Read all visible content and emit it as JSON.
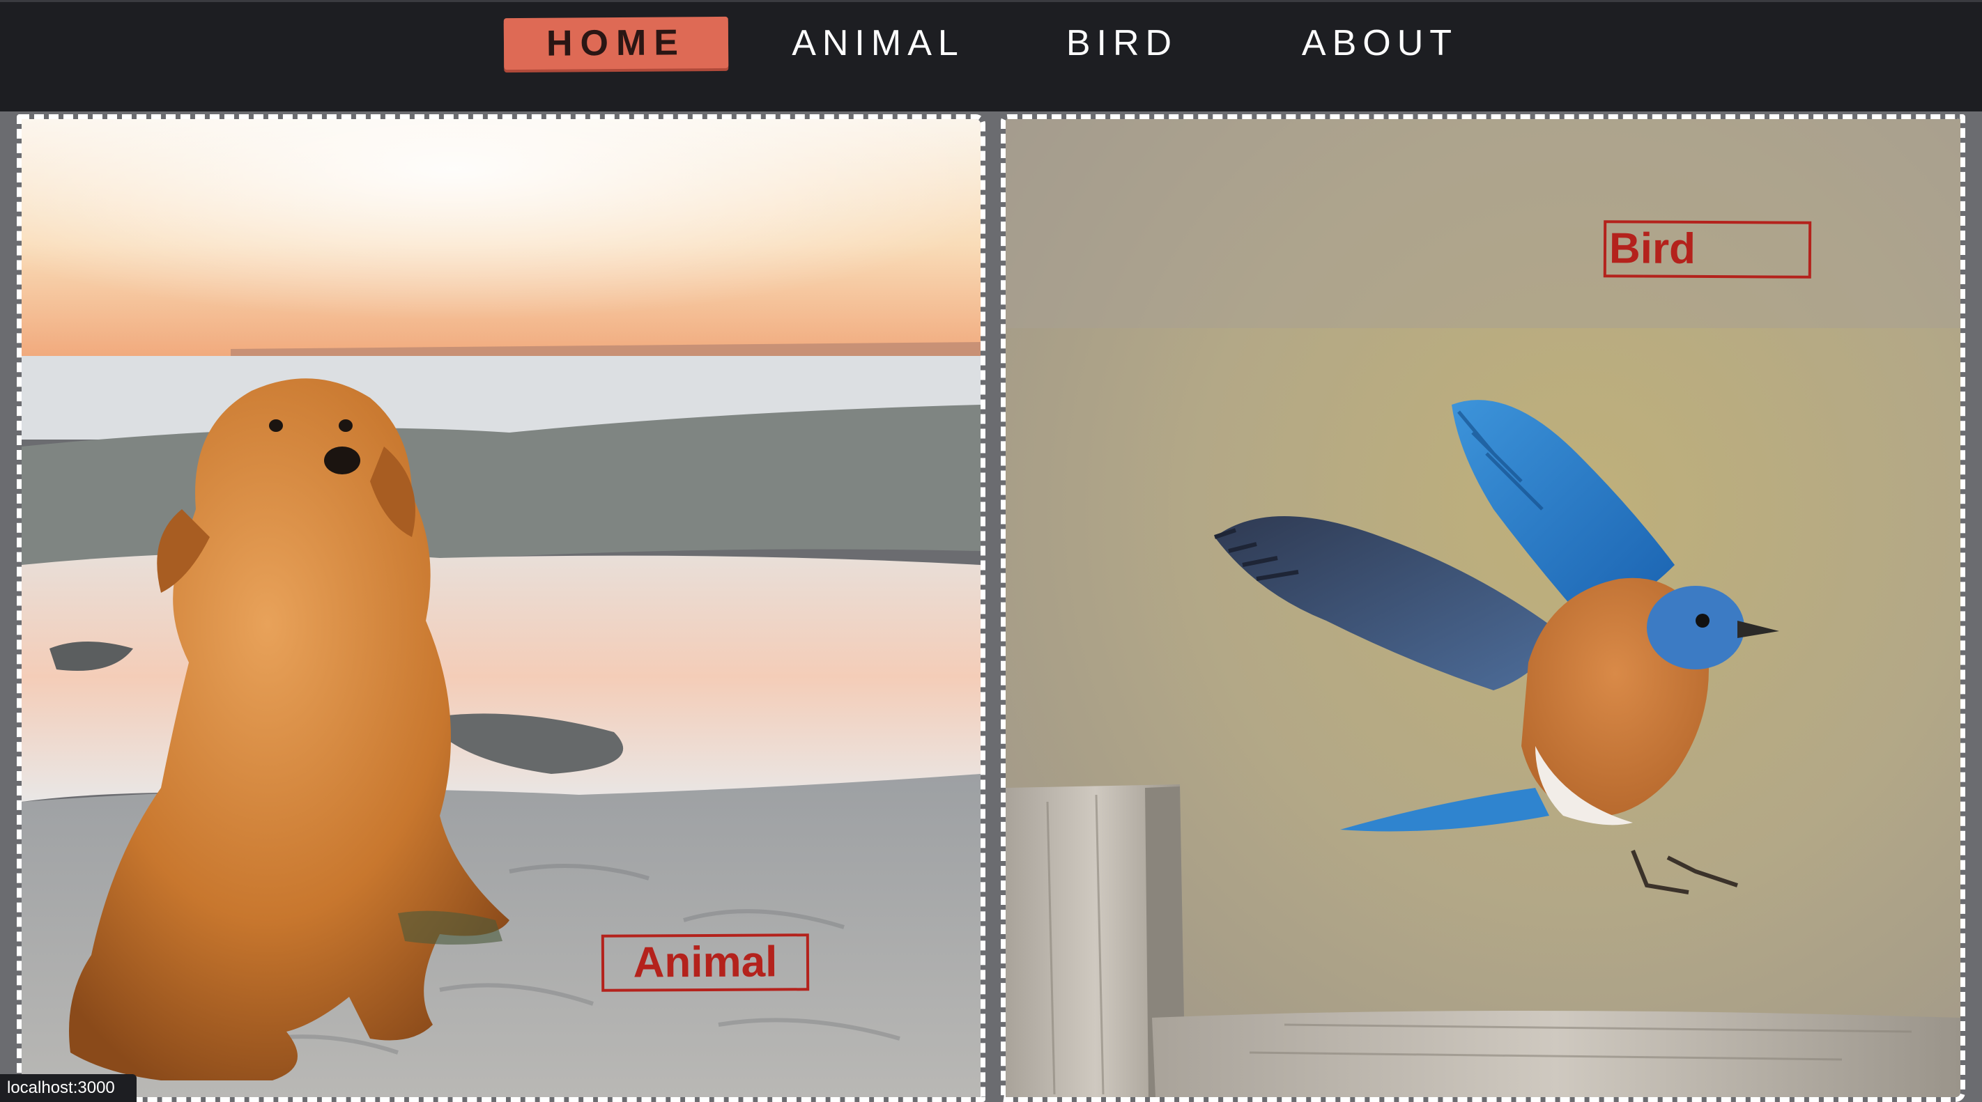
{
  "nav": {
    "items": [
      {
        "label": "HOME",
        "active": true
      },
      {
        "label": "ANIMAL",
        "active": false
      },
      {
        "label": "BIRD",
        "active": false
      },
      {
        "label": "ABOUT",
        "active": false
      }
    ]
  },
  "cards": [
    {
      "label": "Animal",
      "image": "golden-retriever-on-beach"
    },
    {
      "label": "Bird",
      "image": "bluebird-landing-on-fence"
    }
  ],
  "status": {
    "url": "localhost:3000"
  },
  "colors": {
    "nav_bg": "#1d1e22",
    "active_tab": "#de6a55",
    "label_red": "#b4221c",
    "card_border": "#ffffff"
  }
}
